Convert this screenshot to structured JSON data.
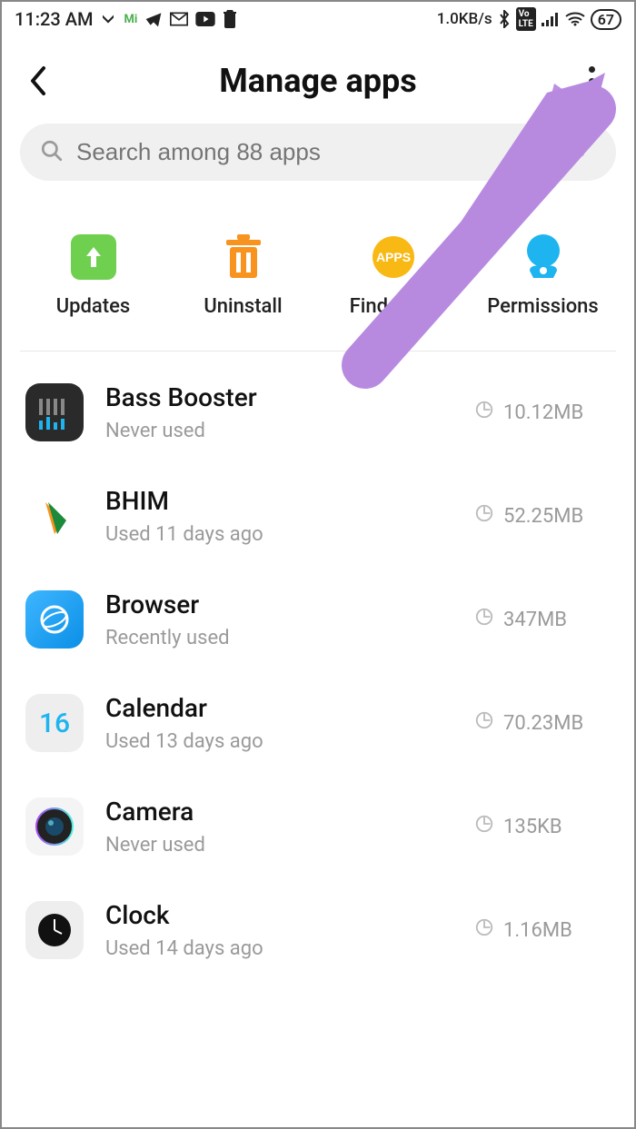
{
  "status_bar": {
    "time": "11:23 AM",
    "speed": "1.0KB/s",
    "battery": "67"
  },
  "header": {
    "title": "Manage apps"
  },
  "search": {
    "placeholder": "Search among 88 apps"
  },
  "quick_actions": [
    {
      "label": "Updates"
    },
    {
      "label": "Uninstall"
    },
    {
      "label": "Find apps"
    },
    {
      "label": "Permissions"
    }
  ],
  "apps": [
    {
      "name": "Bass Booster",
      "usage": "Never used",
      "size": "10.12MB"
    },
    {
      "name": "BHIM",
      "usage": "Used 11 days ago",
      "size": "52.25MB"
    },
    {
      "name": "Browser",
      "usage": "Recently used",
      "size": "347MB"
    },
    {
      "name": "Calendar",
      "usage": "Used 13 days ago",
      "size": "70.23MB"
    },
    {
      "name": "Camera",
      "usage": "Never used",
      "size": "135KB"
    },
    {
      "name": "Clock",
      "usage": "Used 14 days ago",
      "size": "1.16MB"
    }
  ]
}
